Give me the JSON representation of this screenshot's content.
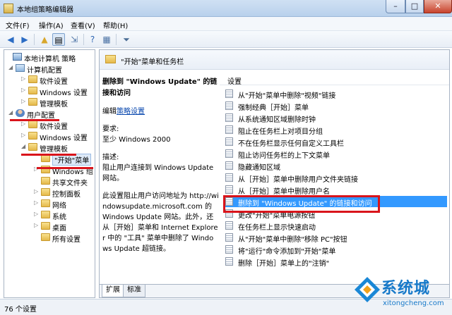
{
  "window": {
    "title": "本地组策略编辑器",
    "min": "–",
    "max": "□",
    "close": "✕"
  },
  "menu": [
    "文件(F)",
    "操作(A)",
    "查看(V)",
    "帮助(H)"
  ],
  "toolbar": {
    "back": "◀",
    "forward": "▶",
    "filter": "⏷"
  },
  "tree": [
    {
      "label": "本地计算机 策略",
      "arrow": "",
      "icon": "pc"
    },
    {
      "label": "计算机配置",
      "arrow": "◢",
      "icon": "comp"
    },
    {
      "label": "软件设置",
      "arrow": "▷",
      "icon": "folder"
    },
    {
      "label": "Windows 设置",
      "arrow": "▷",
      "icon": "folder"
    },
    {
      "label": "管理模板",
      "arrow": "▷",
      "icon": "folder"
    },
    {
      "label": "用户配置",
      "arrow": "◢",
      "icon": "user"
    },
    {
      "label": "软件设置",
      "arrow": "▷",
      "icon": "folder"
    },
    {
      "label": "Windows 设置",
      "arrow": "▷",
      "icon": "folder"
    },
    {
      "label": "管理模板",
      "arrow": "◢",
      "icon": "folder"
    },
    {
      "label": "\"开始\"菜单",
      "arrow": "",
      "icon": "folder",
      "selected": true
    },
    {
      "label": "Windows 组",
      "arrow": "▷",
      "icon": "folder"
    },
    {
      "label": "共享文件夹",
      "arrow": "",
      "icon": "folder"
    },
    {
      "label": "控制面板",
      "arrow": "▷",
      "icon": "folder"
    },
    {
      "label": "网络",
      "arrow": "▷",
      "icon": "folder"
    },
    {
      "label": "系统",
      "arrow": "▷",
      "icon": "folder"
    },
    {
      "label": "桌面",
      "arrow": "▷",
      "icon": "folder"
    },
    {
      "label": "所有设置",
      "arrow": "",
      "icon": "folder"
    }
  ],
  "right": {
    "header": "\"开始\"菜单和任务栏",
    "desc_title": "删除到 \"Windows Update\" 的链接和访问",
    "edit_prefix": "编辑",
    "edit_link": "策略设置",
    "req_label": "要求:",
    "req_value": "至少 Windows 2000",
    "desc_label": "描述:",
    "desc_text": "阻止用户连接到 Windows Update 网站。",
    "desc_more": "此设置阻止用户访问地址为 http://windowsupdate.microsoft.com 的 Windows Update 网站。此外，还从［开始］菜单和 Internet Explorer 中的 \"工具\" 菜单中删除了 Windows Update 超链接。",
    "col_header": "设置",
    "items": [
      "从\"开始\"菜单中删除\"视频\"链接",
      "强制经典［开始］菜单",
      "从系统通知区域删除时钟",
      "阻止在任务栏上对项目分组",
      "不在任务栏显示任何自定义工具栏",
      "阻止访问任务栏的上下文菜单",
      "隐藏通知区域",
      "从［开始］菜单中删除用户文件夹链接",
      "从［开始］菜单中删除用户名",
      "删除到 \"Windows Update\" 的链接和访问",
      "更改\"开始\"菜单电源按钮",
      "在任务栏上显示快速启动",
      "从\"开始\"菜单中删除\"移除 PC\"按钮",
      "将\"运行\"命令添加到\"开始\"菜单",
      "删除［开始］菜单上的\"注销\""
    ],
    "selected_index": 9,
    "tabs": [
      "扩展",
      "标准"
    ]
  },
  "status": "76 个设置",
  "watermark": {
    "text": "系统城",
    "sub": "xitongcheng.com"
  },
  "colors": {
    "selection": "#3399ff",
    "highlight_red": "#d9141b",
    "link": "#0645ad"
  }
}
